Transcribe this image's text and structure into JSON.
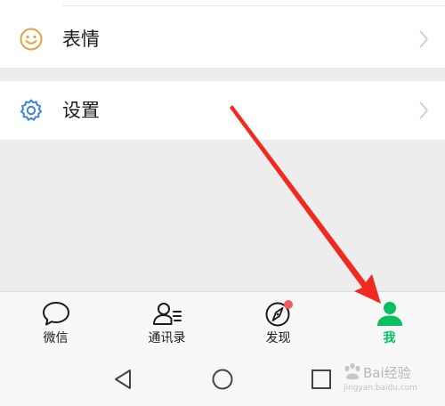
{
  "menu": {
    "items": [
      {
        "label": "表情",
        "icon": "smiley-icon"
      },
      {
        "label": "设置",
        "icon": "gear-icon"
      }
    ]
  },
  "tabbar": {
    "tabs": [
      {
        "label": "微信",
        "icon": "chat-bubble-icon"
      },
      {
        "label": "通讯录",
        "icon": "contacts-icon"
      },
      {
        "label": "发现",
        "icon": "compass-icon"
      },
      {
        "label": "我",
        "icon": "person-icon",
        "selected": true
      }
    ],
    "discover_has_badge": true
  },
  "navbar": {
    "buttons": [
      "back-icon",
      "home-icon",
      "recent-apps-icon"
    ]
  },
  "watermark": {
    "text": "Bai经验",
    "url": "jingyan.baidu.com"
  },
  "colors": {
    "accent_green": "#07c160",
    "badge_red": "#f05b5b",
    "arrow_red": "#f02a1f",
    "sticker_icon": "#e8a13c",
    "settings_icon": "#3f84d6"
  }
}
